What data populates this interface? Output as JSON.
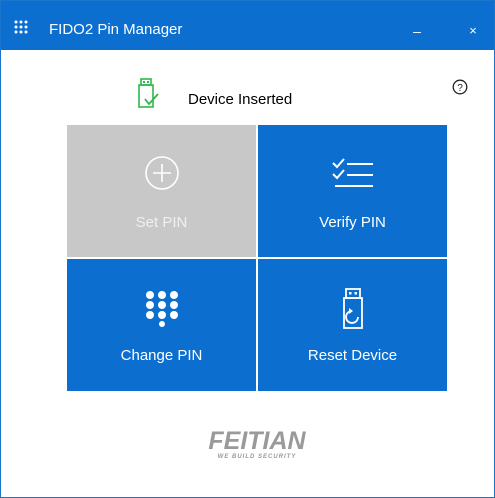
{
  "window": {
    "title": "FIDO2 Pin Manager",
    "minimize_label": "–",
    "close_label": "×"
  },
  "status": {
    "text": "Device Inserted",
    "icon": "usb-key-check-icon"
  },
  "help": {
    "icon": "help-icon"
  },
  "tiles": [
    {
      "label": "Set PIN",
      "icon": "plus-circle-icon",
      "enabled": false
    },
    {
      "label": "Verify PIN",
      "icon": "checklist-icon",
      "enabled": true
    },
    {
      "label": "Change PIN",
      "icon": "keypad-icon",
      "enabled": true
    },
    {
      "label": "Reset Device",
      "icon": "usb-key-reset-icon",
      "enabled": true
    }
  ],
  "logo": {
    "brand": "FEITIAN",
    "tagline": "WE BUILD SECURITY"
  },
  "colors": {
    "accent": "#0c6fd0",
    "disabled": "#c8c8c8",
    "status_green": "#2db84a"
  }
}
